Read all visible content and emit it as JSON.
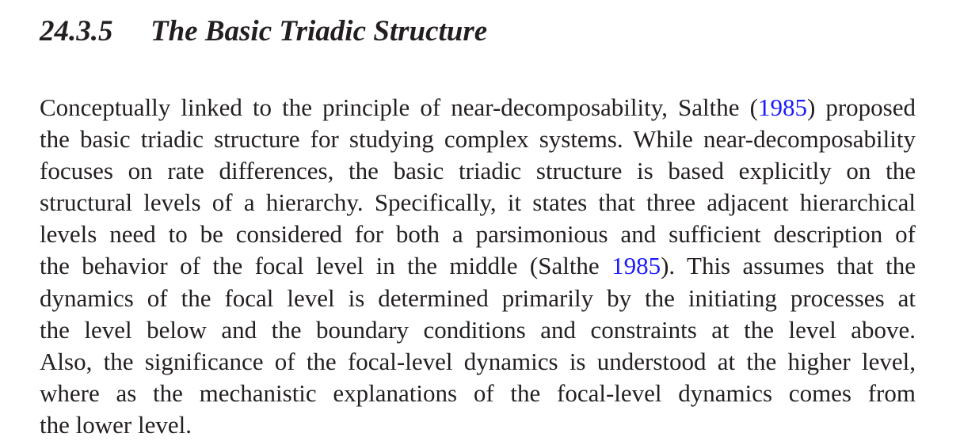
{
  "section": {
    "number": "24.3.5",
    "title": "The Basic Triadic Structure"
  },
  "paragraph": {
    "lines": [
      {
        "pre": "Conceptually linked to the principle of near-decomposability, Salthe (",
        "cite": "1985",
        "post": ") proposed"
      },
      {
        "pre": "the basic triadic structure for studying complex systems. While near-decomposability",
        "cite": "",
        "post": ""
      },
      {
        "pre": "focuses on rate differences, the basic triadic structure is based explicitly on the",
        "cite": "",
        "post": ""
      },
      {
        "pre": "structural levels of a hierarchy. Specifically, it states that three adjacent hierarchical",
        "cite": "",
        "post": ""
      },
      {
        "pre": "levels need to be considered for both a parsimonious and sufficient description of",
        "cite": "",
        "post": ""
      },
      {
        "pre": "the behavior of the focal level in the middle (Salthe ",
        "cite": "1985",
        "post": "). This assumes that the"
      },
      {
        "pre": "dynamics of the focal level is determined primarily by the initiating processes at",
        "cite": "",
        "post": ""
      },
      {
        "pre": "the level below and the boundary conditions and constraints at the level above.",
        "cite": "",
        "post": ""
      },
      {
        "pre": "Also, the significance of the focal-level dynamics is understood at the higher level,",
        "cite": "",
        "post": ""
      },
      {
        "pre": "where as the mechanistic explanations of the focal-level dynamics comes from",
        "cite": "",
        "post": ""
      },
      {
        "pre": "the lower level.",
        "cite": "",
        "post": ""
      }
    ]
  }
}
